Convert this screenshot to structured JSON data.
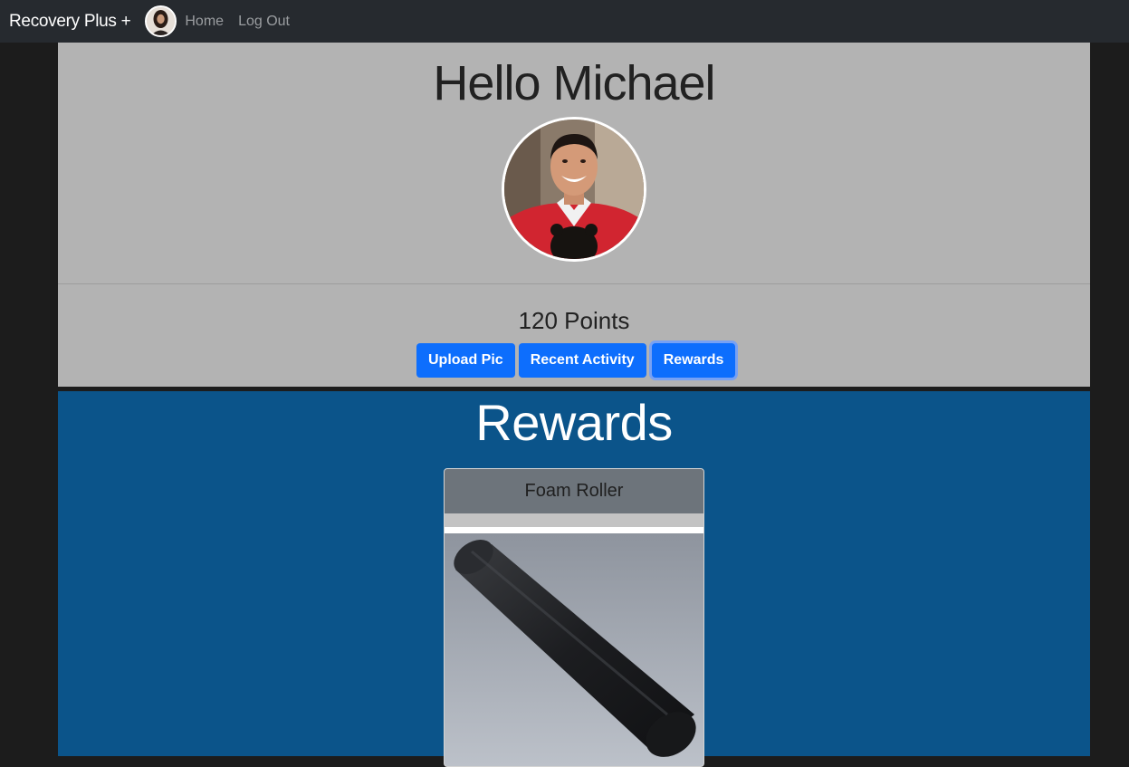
{
  "navbar": {
    "brand": "Recovery Plus +",
    "links": [
      "Home",
      "Log Out"
    ]
  },
  "profile": {
    "greeting": "Hello Michael",
    "points": "120 Points",
    "buttons": [
      "Upload Pic",
      "Recent Activity",
      "Rewards"
    ],
    "active_button": "Rewards"
  },
  "rewards": {
    "title": "Rewards",
    "items": [
      {
        "name": "Foam Roller"
      }
    ]
  },
  "colors": {
    "navbar_bg": "#262a2f",
    "profile_bg": "#b3b3b3",
    "rewards_bg": "#0b548a",
    "button_primary": "#0d6efd",
    "card_header": "#6d747b"
  },
  "icons": {
    "nav_avatar": "user-avatar-icon",
    "profile_photo": "profile-photo"
  }
}
